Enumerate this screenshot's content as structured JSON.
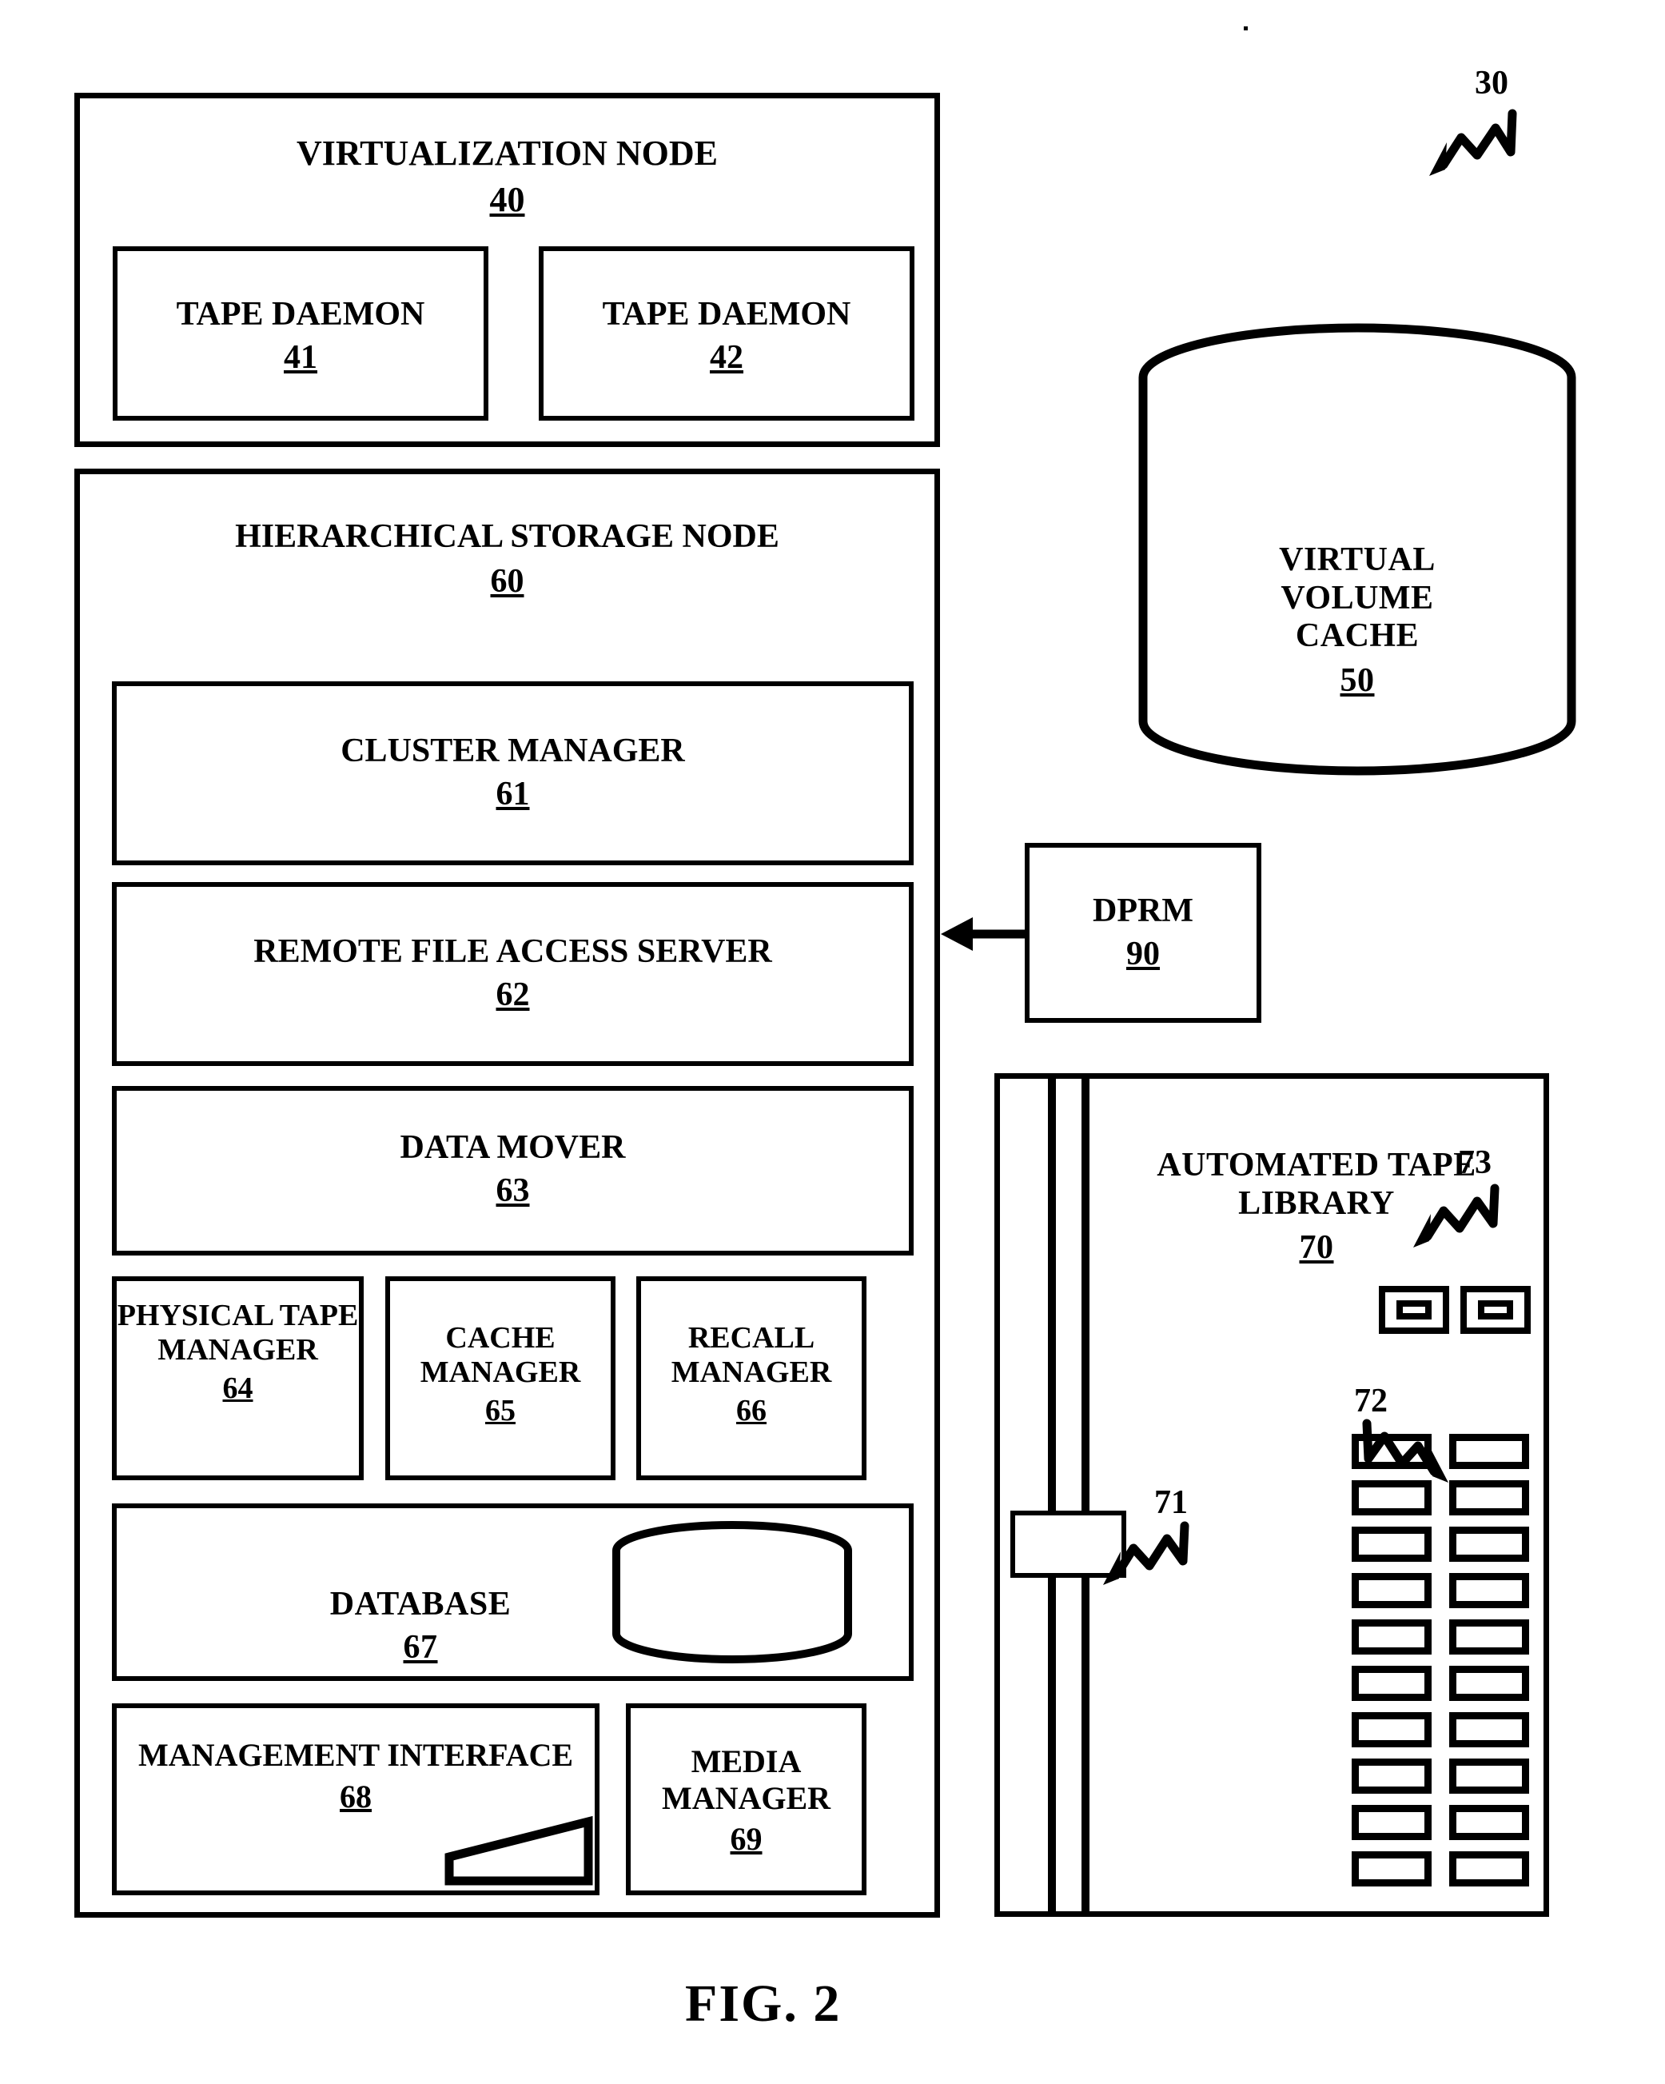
{
  "figure": {
    "caption": "FIG. 2",
    "system_callout": "30"
  },
  "virtualization_node": {
    "title": "VIRTUALIZATION NODE",
    "ref": "40",
    "daemons": [
      {
        "title": "TAPE DAEMON",
        "ref": "41"
      },
      {
        "title": "TAPE DAEMON",
        "ref": "42"
      }
    ]
  },
  "hierarchical_storage_node": {
    "title": "HIERARCHICAL STORAGE NODE",
    "ref": "60",
    "components": [
      {
        "title": "CLUSTER MANAGER",
        "ref": "61"
      },
      {
        "title": "REMOTE FILE ACCESS SERVER",
        "ref": "62"
      },
      {
        "title": "DATA MOVER",
        "ref": "63"
      },
      {
        "title": "PHYSICAL\nTAPE\nMANAGER",
        "ref": "64"
      },
      {
        "title": "CACHE\nMANAGER",
        "ref": "65"
      },
      {
        "title": "RECALL\nMANAGER",
        "ref": "66"
      },
      {
        "title": "DATABASE",
        "ref": "67"
      },
      {
        "title": "MANAGEMENT\nINTERFACE",
        "ref": "68"
      },
      {
        "title": "MEDIA\nMANAGER",
        "ref": "69"
      }
    ]
  },
  "virtual_volume_cache": {
    "title": "VIRTUAL\nVOLUME\nCACHE",
    "ref": "50"
  },
  "dprm": {
    "title": "DPRM",
    "ref": "90"
  },
  "automated_tape_library": {
    "title": "AUTOMATED TAPE\nLIBRARY",
    "ref": "70",
    "robot_callout": "71",
    "cartridges_callout": "72",
    "drives_callout": "73",
    "drive_count": 2,
    "cartridge_rows": 10,
    "cartridge_columns": 2
  },
  "colors": {
    "ink": "#000000",
    "paper": "#ffffff"
  }
}
